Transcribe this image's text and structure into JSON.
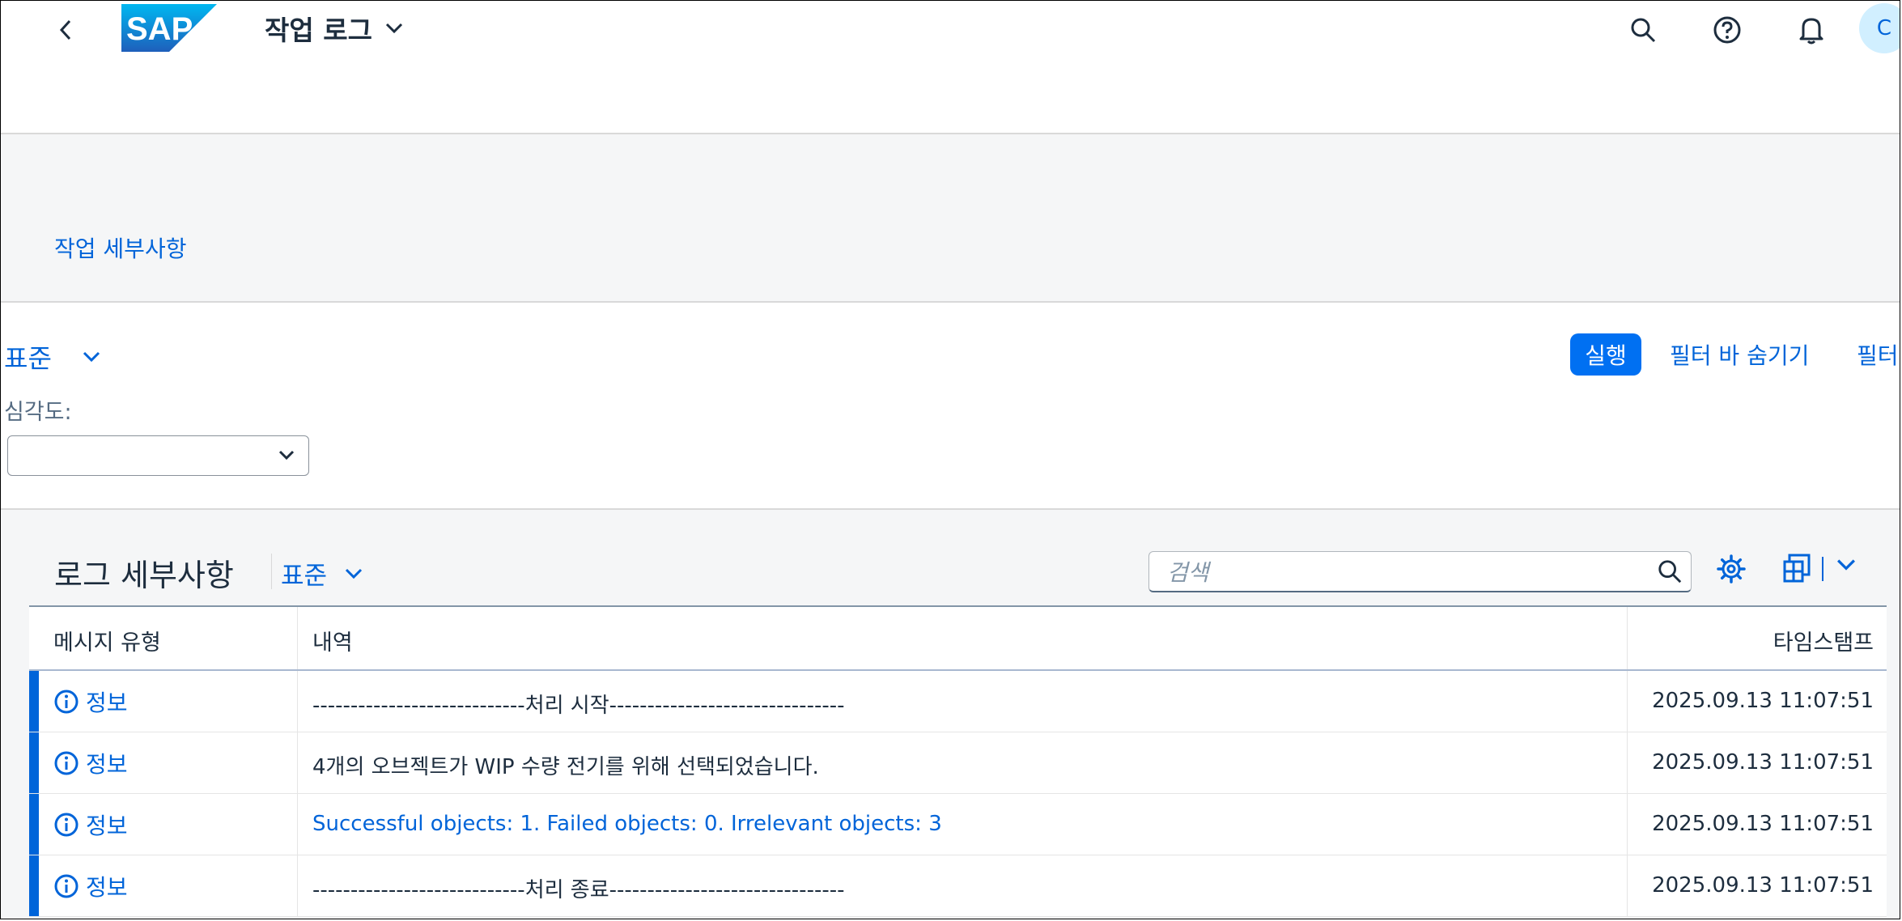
{
  "shell": {
    "app_title": "작업 로그",
    "avatar_initial": "C",
    "icons": [
      "back-icon",
      "search-icon",
      "help-icon",
      "notification-bell-icon"
    ]
  },
  "object_header": {
    "tab_label": "작업 세부사항"
  },
  "filter_bar": {
    "variant_label": "표준",
    "run_label": "실행",
    "hide_filter_bar_label": "필터 바 숨기기",
    "filters_label": "필터",
    "severity_label": "심각도:",
    "severity_value": ""
  },
  "log_table": {
    "title": "로그 세부사항",
    "variant_label": "표준",
    "search_placeholder": "검색",
    "columns": [
      "메시지 유형",
      "내역",
      "타임스탬프"
    ],
    "rows": [
      {
        "type": "정보",
        "text": "----------------------------처리 시작-------------------------------",
        "text_is_link": false,
        "timestamp": "2025.09.13 11:07:51"
      },
      {
        "type": "정보",
        "text": "4개의 오브젝트가 WIP 수량 전기를 위해 선택되었습니다.",
        "text_is_link": false,
        "timestamp": "2025.09.13 11:07:51"
      },
      {
        "type": "정보",
        "text": "Successful objects: 1. Failed objects: 0. Irrelevant objects: 3",
        "text_is_link": true,
        "timestamp": "2025.09.13 11:07:51"
      },
      {
        "type": "정보",
        "text": "----------------------------처리 종료-------------------------------",
        "text_is_link": false,
        "timestamp": "2025.09.13 11:07:51"
      }
    ]
  },
  "colors": {
    "brand_blue": "#0064d9",
    "button_blue": "#0070f2",
    "info_stripe": "#0064d9"
  }
}
